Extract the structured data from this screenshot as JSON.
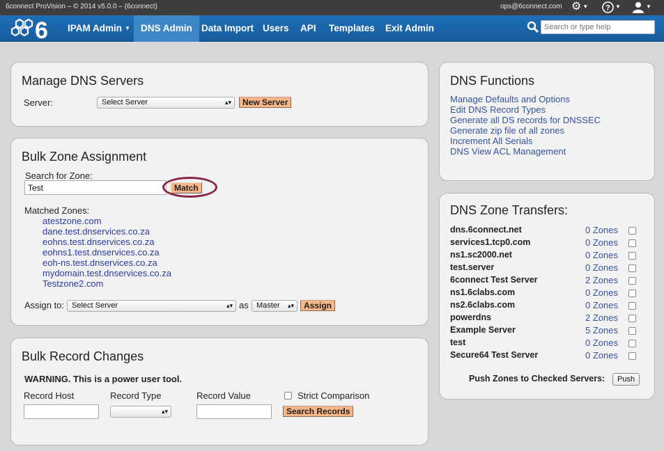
{
  "topbar": {
    "version": "6connect ProVision – © 2014 v5.0.0 – (6connect)",
    "email": "ops@6connect.com"
  },
  "nav": {
    "items": [
      {
        "label": "IPAM Admin",
        "dropdown": true
      },
      {
        "label": "DNS Admin",
        "active": true
      },
      {
        "label": "Data Import"
      },
      {
        "label": "Users"
      },
      {
        "label": "API"
      },
      {
        "label": "Templates"
      },
      {
        "label": "Exit Admin"
      }
    ],
    "search_placeholder": "Search or type help"
  },
  "manage_dns": {
    "title": "Manage DNS Servers",
    "server_label": "Server:",
    "server_select": "Select Server",
    "new_server_button": "New Server"
  },
  "bulk_zone": {
    "title": "Bulk Zone Assignment",
    "search_label": "Search for Zone:",
    "search_value": "Test",
    "match_button": "Match",
    "matched_label": "Matched Zones:",
    "matched_zones": [
      "atestzone.com",
      "dane.test.dnservices.co.za",
      "eohns.test.dnservices.co.za",
      "eohns1.test.dnservices.co.za",
      "eoh-ns.test.dnservices.co.za",
      "mydomain.test.dnservices.co.za",
      "Testzone2.com"
    ],
    "assign_label": "Assign to:",
    "assign_select": "Select Server",
    "as_label": "as",
    "role_select": "Master",
    "assign_button": "Assign"
  },
  "bulk_record": {
    "title": "Bulk Record Changes",
    "warning": "WARNING. This is a power user tool.",
    "host_label": "Record Host",
    "type_label": "Record Type",
    "value_label": "Record Value",
    "strict_label": "Strict Comparison",
    "search_button": "Search Records"
  },
  "dns_functions": {
    "title": "DNS Functions",
    "links": [
      "Manage Defaults and Options",
      "Edit DNS Record Types",
      "Generate all DS records for DNSSEC",
      "Generate zip file of all zones",
      "Increment All Serials",
      "DNS View ACL Management"
    ]
  },
  "zone_transfers": {
    "title": "DNS Zone Transfers:",
    "rows": [
      {
        "server": "dns.6connect.net",
        "zones": "0 Zones"
      },
      {
        "server": "services1.tcp0.com",
        "zones": "0 Zones"
      },
      {
        "server": "ns1.sc2000.net",
        "zones": "0 Zones"
      },
      {
        "server": "test.server",
        "zones": "0 Zones"
      },
      {
        "server": "6connect Test Server",
        "zones": "2 Zones"
      },
      {
        "server": "ns1.6clabs.com",
        "zones": "0 Zones"
      },
      {
        "server": "ns2.6clabs.com",
        "zones": "0 Zones"
      },
      {
        "server": "powerdns",
        "zones": "2 Zones"
      },
      {
        "server": "Example Server",
        "zones": "5 Zones"
      },
      {
        "server": "test",
        "zones": "0 Zones"
      },
      {
        "server": "Secure64 Test Server",
        "zones": "0 Zones"
      }
    ],
    "push_label": "Push Zones to Checked Servers:",
    "push_button": "Push"
  },
  "colors": {
    "nav_blue": "#1f6fb8",
    "nav_active": "#3d86c8",
    "orange_button": "#f8b686",
    "link_blue": "#35539c",
    "highlight_ellipse": "#8a2346"
  }
}
